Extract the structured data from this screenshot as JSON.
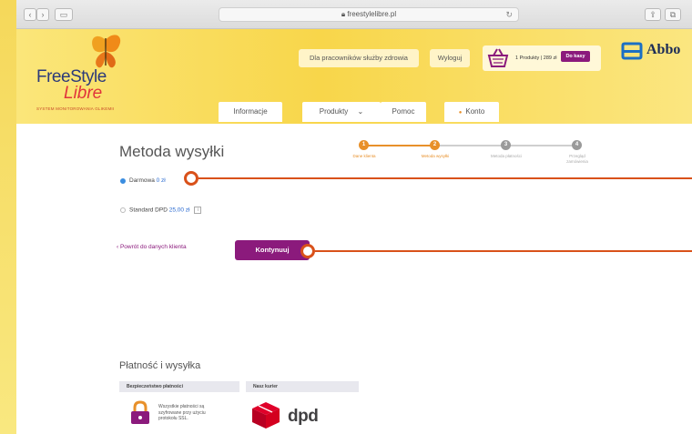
{
  "browser": {
    "url": "freestylelibre.pl",
    "buttons": [
      "‹",
      "›",
      "▭"
    ],
    "right_buttons": [
      "⇪",
      "⧉"
    ]
  },
  "header": {
    "logo_primary": "FreeStyle",
    "logo_secondary": "Libre",
    "logo_tagline": "SYSTEM MONITOROWANIA GLIKEMII",
    "links": {
      "health_pros": "Dla pracowników służby zdrowia",
      "logout": "Wyloguj"
    },
    "cart": {
      "summary": "1 Produkty | 289 zł",
      "checkout_label": "Do kasy"
    },
    "brand": "Abbo",
    "nav": [
      "Informacje",
      "Produkty",
      "Pomoc",
      "Konto"
    ]
  },
  "checkout": {
    "title": "Metoda wysyłki",
    "steps": [
      {
        "number": "1",
        "label": "Dane klienta",
        "state": "done"
      },
      {
        "number": "2",
        "label": "Metoda wysyłki",
        "state": "current"
      },
      {
        "number": "3",
        "label": "Metoda płatności",
        "state": "pending"
      },
      {
        "number": "4",
        "label": "Przegląd zamówienia",
        "state": "pending"
      }
    ],
    "options": [
      {
        "name": "Darmowa",
        "price": "0 zł",
        "selected": true
      },
      {
        "name": "Standard DPD",
        "price": "25,00 zł",
        "selected": false
      }
    ],
    "info_label": "i",
    "back_label": "‹ Powrót do danych klienta",
    "continue_label": "Kontynuuj"
  },
  "footer": {
    "title": "Płatność i wysyłka",
    "secure_header": "Bezpieczeństwo płatności",
    "secure_text": "Wszystkie płatności są szyfrowane przy użyciu protokołu SSL.",
    "courier_header": "Nasz kurier",
    "courier_name": "dpd"
  },
  "colors": {
    "accent_purple": "#8b1a7c",
    "step_orange": "#e8902a",
    "pointer_orange": "#d9511a",
    "header_yellow": "#f8d64a"
  }
}
